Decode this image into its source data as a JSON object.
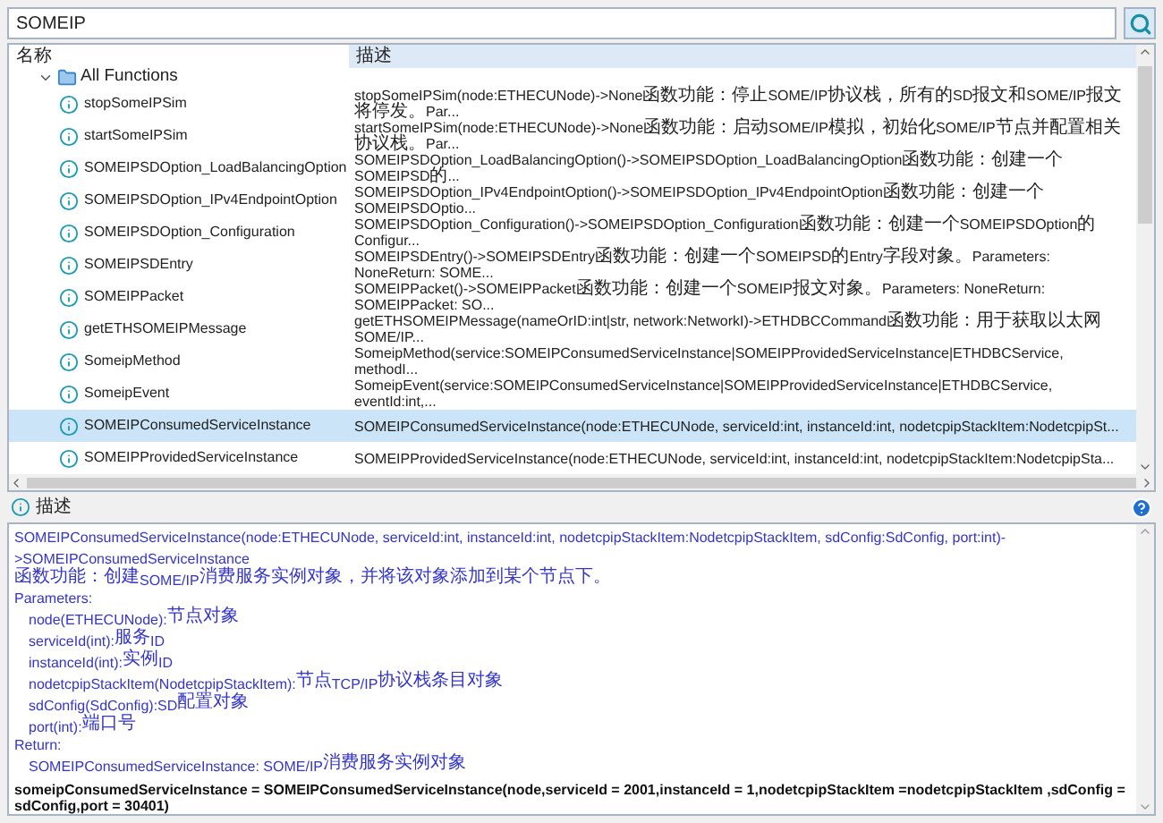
{
  "search": {
    "value": "SOMEIP"
  },
  "tree": {
    "columns": [
      "名称",
      "描述"
    ],
    "root": {
      "label": "All Functions",
      "expanded": true,
      "children": [
        {
          "name": "stopSomeIPSim",
          "description": "stopSomeIPSim(node:ETHECUNode)->None函数功能：停止SOME/IP协议栈，所有的SD报文和SOME/IP报文将停发。Par...",
          "selected": false
        },
        {
          "name": "startSomeIPSim",
          "description": "startSomeIPSim(node:ETHECUNode)->None函数功能：启动SOME/IP模拟，初始化SOME/IP节点并配置相关协议栈。Par...",
          "selected": false
        },
        {
          "name": "SOMEIPSDOption_LoadBalancingOption",
          "description": "SOMEIPSDOption_LoadBalancingOption()->SOMEIPSDOption_LoadBalancingOption函数功能：创建一个SOMEIPSD的...",
          "selected": false
        },
        {
          "name": "SOMEIPSDOption_IPv4EndpointOption",
          "description": "SOMEIPSDOption_IPv4EndpointOption()->SOMEIPSDOption_IPv4EndpointOption函数功能：创建一个SOMEIPSDOptio...",
          "selected": false
        },
        {
          "name": "SOMEIPSDOption_Configuration",
          "description": "SOMEIPSDOption_Configuration()->SOMEIPSDOption_Configuration函数功能：创建一个SOMEIPSDOption的Configur...",
          "selected": false
        },
        {
          "name": "SOMEIPSDEntry",
          "description": "SOMEIPSDEntry()->SOMEIPSDEntry函数功能：创建一个SOMEIPSD的Entry字段对象。Parameters: NoneReturn: SOME...",
          "selected": false
        },
        {
          "name": "SOMEIPPacket",
          "description": "SOMEIPPacket()->SOMEIPPacket函数功能：创建一个SOMEIP报文对象。Parameters: NoneReturn: SOMEIPPacket: SO...",
          "selected": false
        },
        {
          "name": "getETHSOMEIPMessage",
          "description": "getETHSOMEIPMessage(nameOrID:int|str, network:NetworkI)->ETHDBCCommand函数功能：用于获取以太网SOME/IP...",
          "selected": false
        },
        {
          "name": "SomeipMethod",
          "description": "SomeipMethod(service:SOMEIPConsumedServiceInstance|SOMEIPProvidedServiceInstance|ETHDBCService, methodI...",
          "selected": false
        },
        {
          "name": "SomeipEvent",
          "description": "SomeipEvent(service:SOMEIPConsumedServiceInstance|SOMEIPProvidedServiceInstance|ETHDBCService, eventId:int,...",
          "selected": false
        },
        {
          "name": "SOMEIPConsumedServiceInstance",
          "description": "SOMEIPConsumedServiceInstance(node:ETHECUNode, serviceId:int, instanceId:int, nodetcpipStackItem:NodetcpipSt...",
          "selected": true
        },
        {
          "name": "SOMEIPProvidedServiceInstance",
          "description": "SOMEIPProvidedServiceInstance(node:ETHECUNode, serviceId:int, instanceId:int, nodetcpipStackItem:NodetcpipSta...",
          "selected": false
        }
      ]
    }
  },
  "detail": {
    "title": "描述",
    "signature": "SOMEIPConsumedServiceInstance(node:ETHECUNode, serviceId:int, instanceId:int, nodetcpipStackItem:NodetcpipStackItem, sdConfig:SdConfig, port:int)->SOMEIPConsumedServiceInstance",
    "summary": "函数功能：创建SOME/IP消费服务实例对象，并将该对象添加到某个节点下。",
    "parameters_label": "Parameters:",
    "parameters": [
      "node(ETHECUNode):节点对象",
      "serviceId(int):服务ID",
      "instanceId(int):实例ID",
      "nodetcpipStackItem(NodetcpipStackItem):节点TCP/IP协议栈条目对象",
      "sdConfig(SdConfig):SD配置对象",
      "port(int):端口号"
    ],
    "return_label": "Return:",
    "return_value": "SOMEIPConsumedServiceInstance: SOME/IP消费服务实例对象",
    "example": "someipConsumedServiceInstance = SOMEIPConsumedServiceInstance(node,serviceId = 2001,instanceId = 1,nodetcpipStackItem =nodetcpipStackItem ,sdConfig = sdConfig,port = 30401)"
  }
}
